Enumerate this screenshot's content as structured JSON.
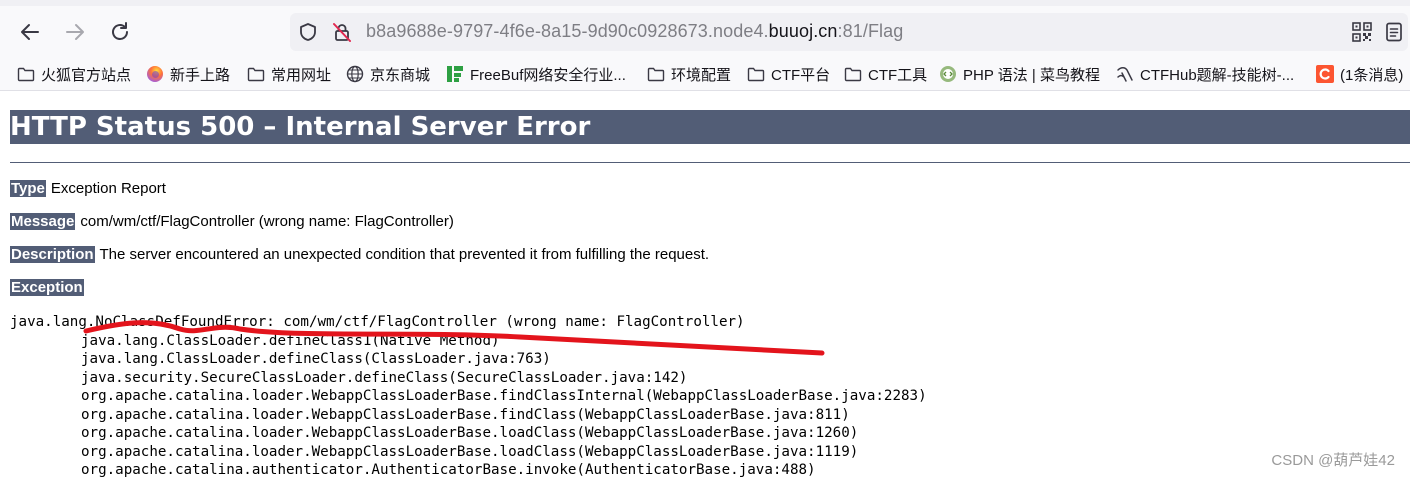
{
  "browser": {
    "url_prefix": "b8a9688e-9797-4f6e-8a15-9d90c0928673.node4.",
    "url_host": "buuoj.cn",
    "url_suffix": ":81/Flag"
  },
  "bookmarks": [
    {
      "label": "火狐官方站点",
      "icon": "folder-icon"
    },
    {
      "label": "新手上路",
      "icon": "firefox-icon"
    },
    {
      "label": "常用网址",
      "icon": "folder-icon"
    },
    {
      "label": "京东商城",
      "icon": "globe-icon"
    },
    {
      "label": "FreeBuf网络安全行业...",
      "icon": "freebuf-icon"
    },
    {
      "label": "环境配置",
      "icon": "folder-icon"
    },
    {
      "label": "CTF平台",
      "icon": "folder-icon"
    },
    {
      "label": "CTF工具",
      "icon": "folder-icon"
    },
    {
      "label": "PHP 语法 | 菜鸟教程",
      "icon": "runoob-icon"
    },
    {
      "label": "CTFHub题解-技能树-...",
      "icon": "ctfhub-icon"
    },
    {
      "label": "(1条消息)",
      "icon": "csdn-icon"
    }
  ],
  "page": {
    "title": "HTTP Status 500 – Internal Server Error",
    "type_label": "Type",
    "type_value": "Exception Report",
    "message_label": "Message",
    "message_value": "com/wm/ctf/FlagController (wrong name: FlagController)",
    "description_label": "Description",
    "description_value": "The server encountered an unexpected condition that prevented it from fulfilling the request.",
    "exception_label": "Exception",
    "stack_trace": [
      "java.lang.NoClassDefFoundError: com/wm/ctf/FlagController (wrong name: FlagController)",
      "\tjava.lang.ClassLoader.defineClass1(Native Method)",
      "\tjava.lang.ClassLoader.defineClass(ClassLoader.java:763)",
      "\tjava.security.SecureClassLoader.defineClass(SecureClassLoader.java:142)",
      "\torg.apache.catalina.loader.WebappClassLoaderBase.findClassInternal(WebappClassLoaderBase.java:2283)",
      "\torg.apache.catalina.loader.WebappClassLoaderBase.findClass(WebappClassLoaderBase.java:811)",
      "\torg.apache.catalina.loader.WebappClassLoaderBase.loadClass(WebappClassLoaderBase.java:1260)",
      "\torg.apache.catalina.loader.WebappClassLoaderBase.loadClass(WebappClassLoaderBase.java:1119)",
      "\torg.apache.catalina.authenticator.AuthenticatorBase.invoke(AuthenticatorBase.java:488)"
    ]
  },
  "watermark": "CSDN @葫芦娃42",
  "colors": {
    "tomcat_header": "#525d76",
    "annotation_red": "#e3141c",
    "toolbar_bg": "#f9f9fb",
    "urlbar_bg": "#f0f0f4"
  }
}
